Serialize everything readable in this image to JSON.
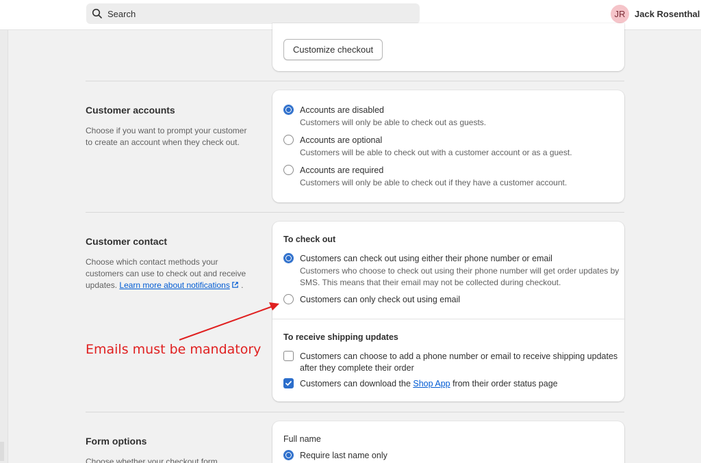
{
  "topbar": {
    "search_placeholder": "Search",
    "user_initials": "JR",
    "user_name": "Jack Rosenthal"
  },
  "checkout_card": {
    "button_label": "Customize checkout"
  },
  "customer_accounts": {
    "title": "Customer accounts",
    "description": "Choose if you want to prompt your customer to create an account when they check out.",
    "options": [
      {
        "label": "Accounts are disabled",
        "help": "Customers will only be able to check out as guests.",
        "selected": true
      },
      {
        "label": "Accounts are optional",
        "help": "Customers will be able to check out with a customer account or as a guest.",
        "selected": false
      },
      {
        "label": "Accounts are required",
        "help": "Customers will only be able to check out if they have a customer account.",
        "selected": false
      }
    ]
  },
  "customer_contact": {
    "title": "Customer contact",
    "description": "Choose which contact methods your customers can use to check out and receive updates.",
    "description_link": "Learn more about notifications",
    "description_end": ".",
    "checkout_heading": "To check out",
    "checkout_options": [
      {
        "label": "Customers can check out using either their phone number or email",
        "help": "Customers who choose to check out using their phone number will get order updates by SMS. This means that their email may not be collected during checkout.",
        "selected": true
      },
      {
        "label": "Customers can only check out using email",
        "selected": false
      }
    ],
    "shipping_heading": "To receive shipping updates",
    "shipping_options": [
      {
        "label": "Customers can choose to add a phone number or email to receive shipping updates after they complete their order",
        "checked": false
      },
      {
        "label_before": "Customers can download the ",
        "label_link": "Shop App",
        "label_after": " from their order status page",
        "checked": true
      }
    ]
  },
  "form_options": {
    "title": "Form options",
    "description": "Choose whether your checkout form",
    "full_name_label": "Full name",
    "full_name_option": "Require last name only"
  },
  "annotation": {
    "text": "Emails must be mandatory",
    "color": "#e02020"
  },
  "colors": {
    "accent": "#2c6ecb",
    "link": "#005bd3"
  }
}
